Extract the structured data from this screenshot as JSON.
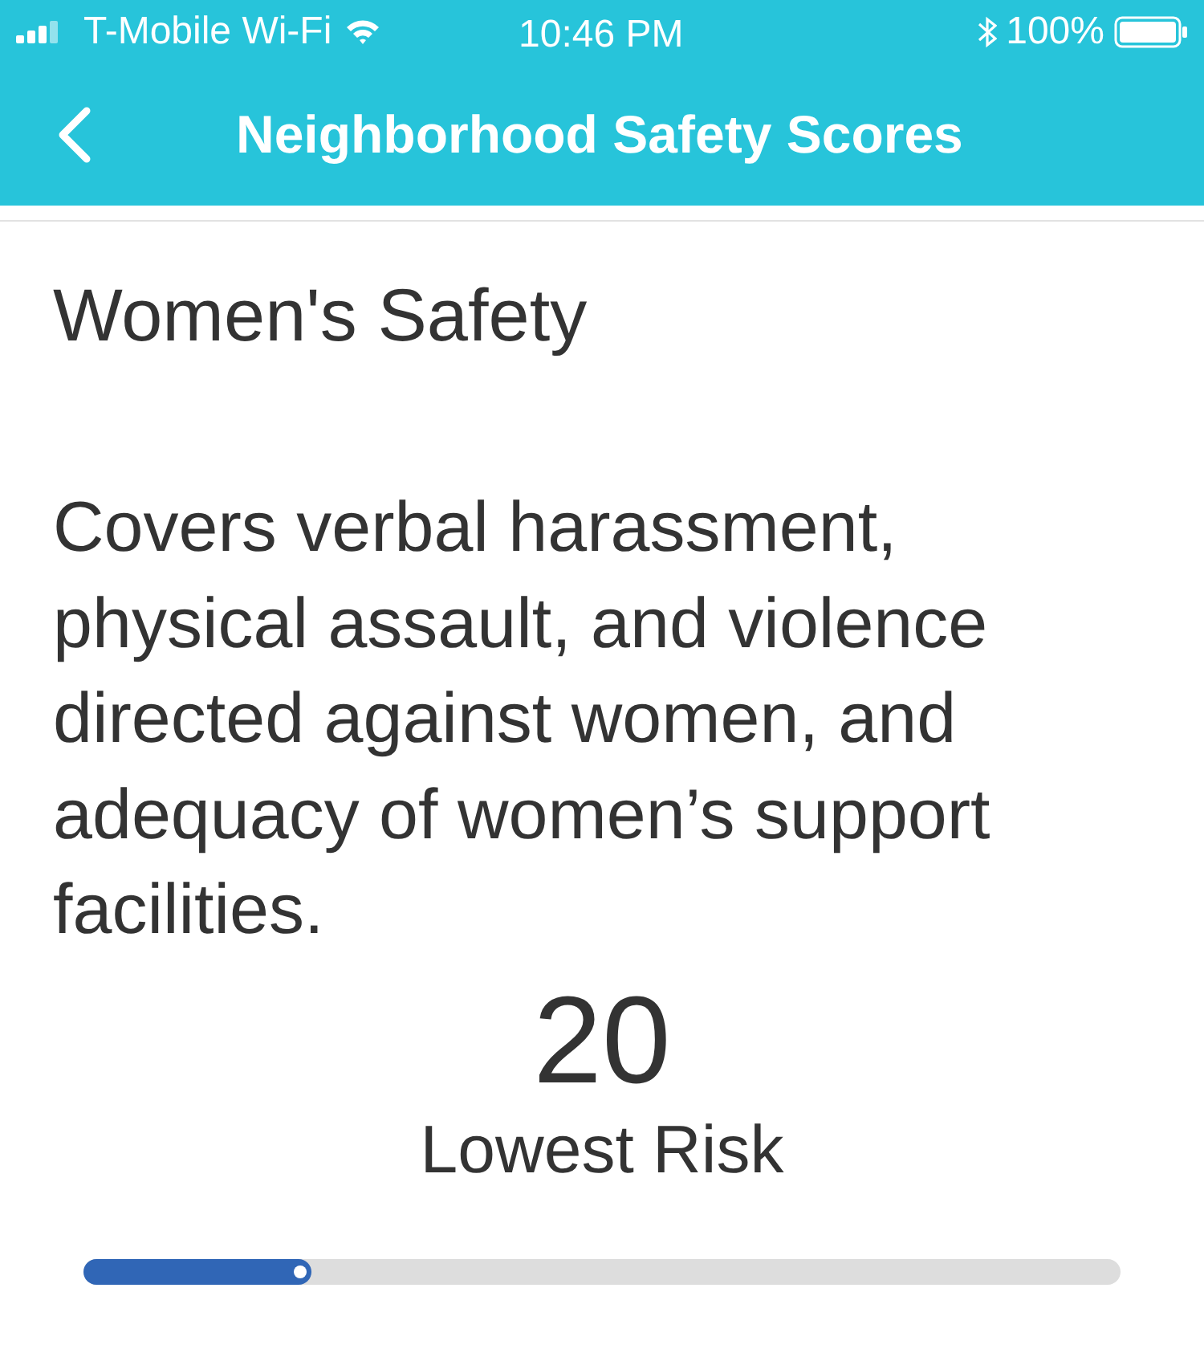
{
  "status_bar": {
    "carrier": "T-Mobile Wi-Fi",
    "time": "10:46 PM",
    "battery": "100%"
  },
  "nav": {
    "title": "Neighborhood Safety Scores"
  },
  "category": {
    "title": "Women's Safety",
    "description": "Covers verbal harassment, physical assault, and violence directed against women, and adequacy of women’s support facilities."
  },
  "score": {
    "value": "20",
    "label": "Lowest Risk",
    "level": 0.22
  }
}
